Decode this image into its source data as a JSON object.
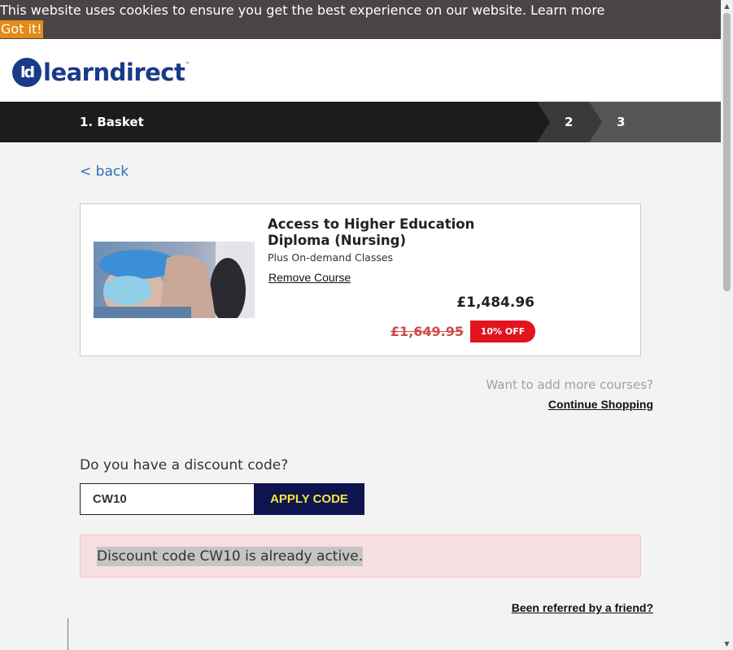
{
  "cookie_bar": {
    "text": "This website uses cookies to ensure you get the best experience on our website.",
    "learn_more": "Learn more",
    "button": "Got it!"
  },
  "header": {
    "logo_text": "learndirect",
    "logo_mark": "ld",
    "brand_color": "#1a3a8a"
  },
  "steps": {
    "step1": "1. Basket",
    "step2": "2",
    "step3": "3"
  },
  "nav": {
    "back": "< back"
  },
  "course": {
    "title": "Access to Higher Education Diploma (Nursing)",
    "subtitle": "Plus On-demand Classes",
    "remove": "Remove Course",
    "price": "£1,484.96",
    "old_price": "£1,649.95",
    "discount_badge": "10% OFF"
  },
  "more_courses": {
    "prompt": "Want to add more courses?",
    "link": "Continue Shopping"
  },
  "discount": {
    "question": "Do you have a discount code?",
    "code_value": "CW10",
    "apply_label": "APPLY CODE",
    "message": "Discount code CW10 is already active."
  },
  "referral": {
    "link": "Been referred by a friend?"
  },
  "icons": {
    "scroll_up": "triangle-up-icon",
    "scroll_down": "triangle-down-icon"
  }
}
